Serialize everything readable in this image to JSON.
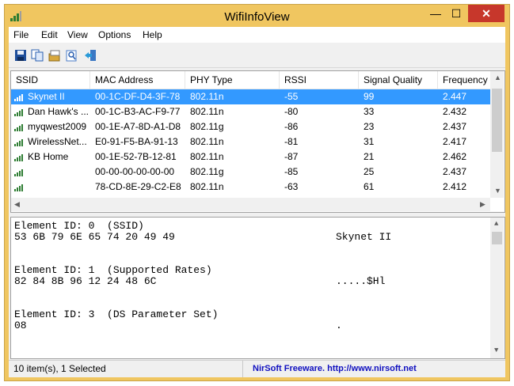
{
  "window": {
    "title": "WifiInfoView"
  },
  "controls": {
    "minimize": "—",
    "maximize": "☐",
    "close": "✕"
  },
  "menu": [
    "File",
    "Edit",
    "View",
    "Options",
    "Help"
  ],
  "toolbar": [
    "save-icon",
    "copy-icon",
    "properties-icon",
    "find-icon",
    "exit-icon"
  ],
  "list": {
    "columns": [
      "SSID",
      "MAC Address",
      "PHY Type",
      "RSSI",
      "Signal Quality",
      "Frequency"
    ],
    "rows": [
      {
        "ssid": "Skynet II",
        "mac": "00-1C-DF-D4-3F-78",
        "phy": "802.11n",
        "rssi": "-55",
        "quality": "99",
        "freq": "2.447",
        "selected": true
      },
      {
        "ssid": "Dan Hawk's ...",
        "mac": "00-1C-B3-AC-F9-77",
        "phy": "802.11n",
        "rssi": "-80",
        "quality": "33",
        "freq": "2.432"
      },
      {
        "ssid": "myqwest2009",
        "mac": "00-1E-A7-8D-A1-D8",
        "phy": "802.11g",
        "rssi": "-86",
        "quality": "23",
        "freq": "2.437"
      },
      {
        "ssid": "WirelessNet...",
        "mac": "E0-91-F5-BA-91-13",
        "phy": "802.11n",
        "rssi": "-81",
        "quality": "31",
        "freq": "2.417"
      },
      {
        "ssid": "KB Home",
        "mac": "00-1E-52-7B-12-81",
        "phy": "802.11n",
        "rssi": "-87",
        "quality": "21",
        "freq": "2.462"
      },
      {
        "ssid": "",
        "mac": "00-00-00-00-00-00",
        "phy": "802.11g",
        "rssi": "-85",
        "quality": "25",
        "freq": "2.437"
      },
      {
        "ssid": "",
        "mac": "78-CD-8E-29-C2-E8",
        "phy": "802.11n",
        "rssi": "-63",
        "quality": "61",
        "freq": "2.412"
      },
      {
        "ssid": "",
        "mac": "78-CD-8E-29-C2-E8",
        "phy": "802.11n",
        "rssi": "-63",
        "quality": "61",
        "freq": "2.412"
      }
    ]
  },
  "detail": {
    "elements": [
      {
        "header": "Element ID: 0  (SSID)",
        "hex": "53 6B 79 6E 65 74 20 49 49",
        "ascii": "Skynet II"
      },
      {
        "header": "Element ID: 1  (Supported Rates)",
        "hex": "82 84 8B 96 12 24 48 6C",
        "ascii": ".....$Hl"
      },
      {
        "header": "Element ID: 3  (DS Parameter Set)",
        "hex": "08",
        "ascii": "."
      }
    ]
  },
  "status": {
    "left": "10 item(s), 1 Selected",
    "right": "NirSoft Freeware.  http://www.nirsoft.net"
  }
}
